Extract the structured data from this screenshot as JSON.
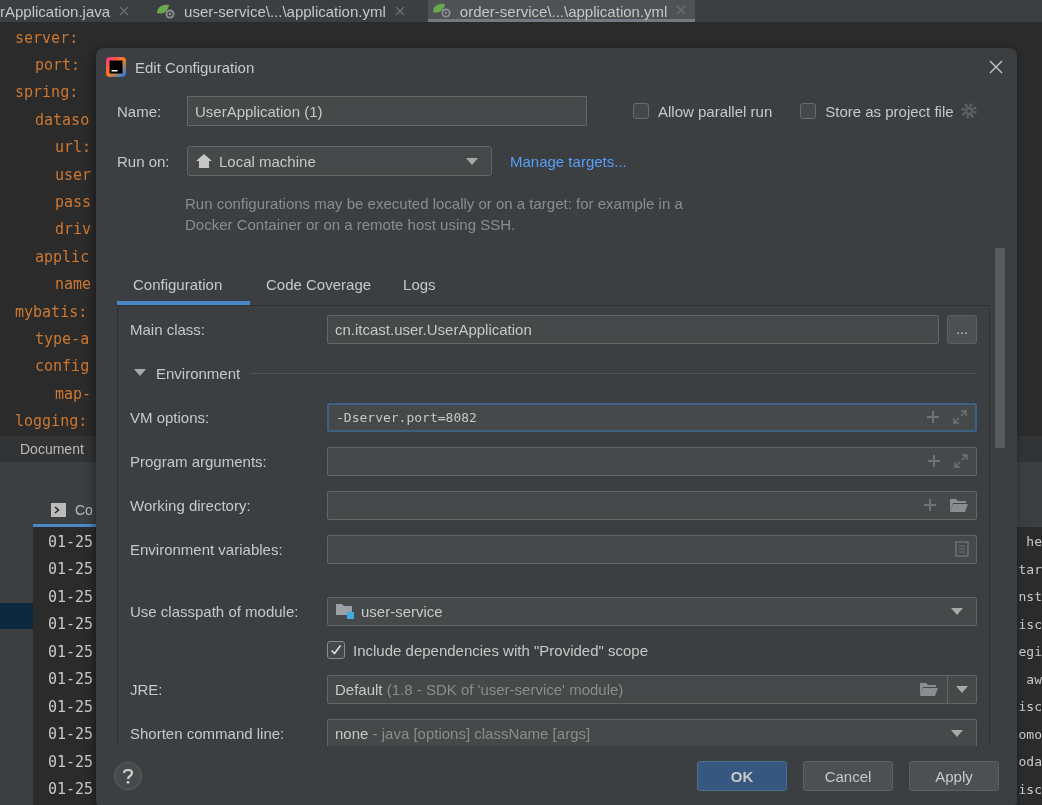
{
  "editor_tabs": [
    {
      "label": "rApplication.java",
      "selected": false,
      "spring": false
    },
    {
      "label": "user-service\\...\\application.yml",
      "selected": false,
      "spring": true
    },
    {
      "label": "order-service\\...\\application.yml",
      "selected": true,
      "spring": true
    }
  ],
  "code": [
    {
      "key": "server:",
      "children": [
        {
          "key": "port:"
        }
      ]
    },
    {
      "key": "spring:",
      "children": [
        {
          "key": "dataso",
          "children": [
            {
              "key": "url:"
            },
            {
              "key": "user"
            },
            {
              "key": "pass"
            },
            {
              "key": "driv"
            }
          ]
        },
        {
          "key": "applic",
          "children": [
            {
              "key": "name"
            }
          ]
        }
      ]
    },
    {
      "key": "mybatis:",
      "children": [
        {
          "key": "type-a"
        },
        {
          "key": "config",
          "children": [
            {
              "key": "map-"
            }
          ]
        }
      ]
    },
    {
      "key": "logging:"
    }
  ],
  "breadcrumb": "Document",
  "console": {
    "tab": "Co",
    "rows": [
      {
        "time": "01-25",
        "tail": "he"
      },
      {
        "time": "01-25",
        "tail": "tar"
      },
      {
        "time": "01-25",
        "tail": "nst"
      },
      {
        "time": "01-25",
        "tail": "isc"
      },
      {
        "time": "01-25",
        "tail": "egi"
      },
      {
        "time": "01-25",
        "tail": "aw"
      },
      {
        "time": "01-25",
        "tail": "isc"
      },
      {
        "time": "01-25",
        "tail": "omo"
      },
      {
        "time": "01-25",
        "tail": "oda"
      },
      {
        "time": "01-25",
        "tail": "isc"
      }
    ]
  },
  "dialog": {
    "title": "Edit Configuration",
    "name": {
      "label": "Name:",
      "value": "UserApplication (1)"
    },
    "options": [
      {
        "label": "Allow parallel run",
        "checked": false
      },
      {
        "label": "Store as project file",
        "checked": false
      }
    ],
    "run_on": {
      "label": "Run on:",
      "value": "Local machine",
      "link": "Manage targets..."
    },
    "hint": "Run configurations may be executed locally or on a target: for example in a Docker Container or on a remote host using SSH.",
    "tabs": [
      {
        "label": "Configuration",
        "selected": true
      },
      {
        "label": "Code Coverage",
        "selected": false
      },
      {
        "label": "Logs",
        "selected": false
      }
    ],
    "rows": [
      {
        "kind": "class",
        "label": "Main class:",
        "value": "cn.itcast.user.UserApplication",
        "button": "..."
      },
      {
        "kind": "section",
        "label": "Environment",
        "expanded": true
      },
      {
        "kind": "expandable",
        "label": "VM options:",
        "value": "-Dserver.port=8082",
        "focused": true
      },
      {
        "kind": "expandable",
        "label": "Program arguments:",
        "focused": false
      },
      {
        "kind": "directory",
        "label": "Working directory:"
      },
      {
        "kind": "env",
        "label": "Environment variables:"
      },
      {
        "kind": "module",
        "label": "Use classpath of module:",
        "value": "user-service"
      },
      {
        "kind": "checkbox",
        "label": "Include dependencies with \"Provided\" scope",
        "checked": true
      },
      {
        "kind": "jre",
        "label": "JRE:",
        "value": "Default",
        "hint": "(1.8 - SDK of 'user-service' module)"
      },
      {
        "kind": "combo",
        "label": "Shorten command line:",
        "value": "none",
        "hint": "- java [options] className [args]"
      }
    ],
    "buttons": [
      {
        "label": "OK",
        "default": true
      },
      {
        "label": "Cancel",
        "default": false
      },
      {
        "label": "Apply",
        "default": false
      }
    ]
  }
}
